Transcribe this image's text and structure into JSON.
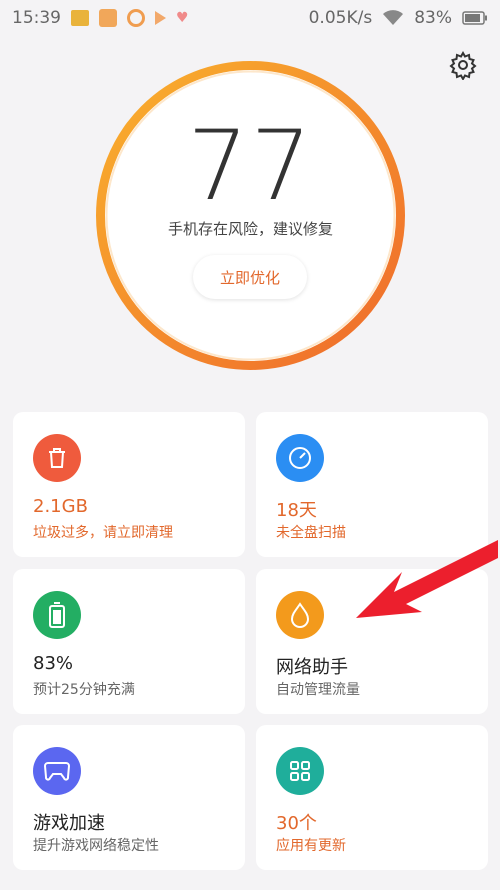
{
  "status_bar": {
    "time": "15:39",
    "net_speed": "0.05K/s",
    "battery": "83%"
  },
  "score": {
    "value": "77",
    "message": "手机存在风险，建议修复",
    "button_label": "立即优化"
  },
  "cards": [
    {
      "title": "2.1GB",
      "subtitle": "垃圾过多，请立即清理",
      "icon": "trash-icon",
      "color": "#ef5b3d"
    },
    {
      "title": "18天",
      "subtitle": "未全盘扫描",
      "icon": "scan-icon",
      "color": "#2b8ef3"
    },
    {
      "title": "83%",
      "subtitle": "预计25分钟充满",
      "icon": "battery-icon",
      "color": "#23ae63"
    },
    {
      "title": "网络助手",
      "subtitle": "自动管理流量",
      "icon": "drop-icon",
      "color": "#f39a1c"
    },
    {
      "title": "游戏加速",
      "subtitle": "提升游戏网络稳定性",
      "icon": "gamepad-icon",
      "color": "#5b67f0"
    },
    {
      "title": "30个",
      "subtitle": "应用有更新",
      "icon": "apps-grid-icon",
      "color": "#1fae9b"
    }
  ],
  "colors": {
    "ring_start": "#f9b12d",
    "ring_end": "#ef6a2c",
    "warning_text": "#e2682c",
    "annotation_arrow": "#ec1f2d"
  }
}
